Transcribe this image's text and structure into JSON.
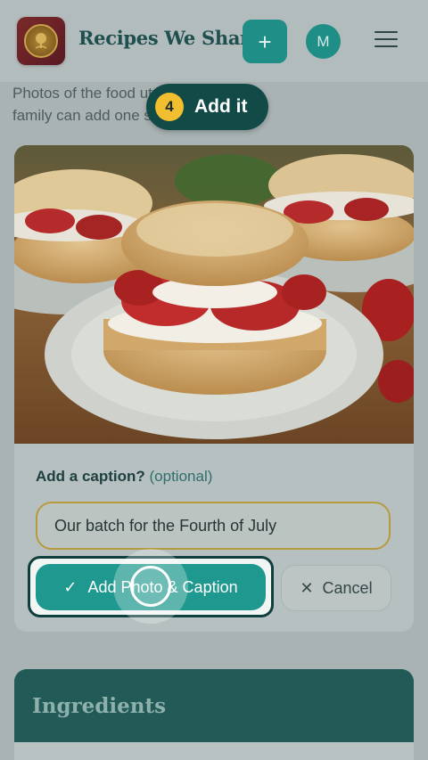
{
  "header": {
    "app_title": "Recipes We Share",
    "add_label": "+",
    "avatar_initial": "M",
    "logo_icon": "tree-of-life-logo",
    "menu_icon": "hamburger-menu-icon"
  },
  "intro": {
    "line1": "Photos of the food                       ut. Anyone in the",
    "line2": "family can add one                      s the cover."
  },
  "tour": {
    "step_number": "4",
    "step_label": "Add it"
  },
  "caption": {
    "label": "Add a caption?",
    "optional": "(optional)",
    "value": "Our batch for the Fourth of July"
  },
  "actions": {
    "primary_label": "Add Photo & Caption",
    "primary_icon": "✓",
    "cancel_label": "Cancel",
    "cancel_icon": "✕"
  },
  "ingredients": {
    "title": "Ingredients"
  },
  "colors": {
    "accent": "#1f998f",
    "step_badge": "#f0be2e",
    "tooltip_bg": "#124a47"
  }
}
